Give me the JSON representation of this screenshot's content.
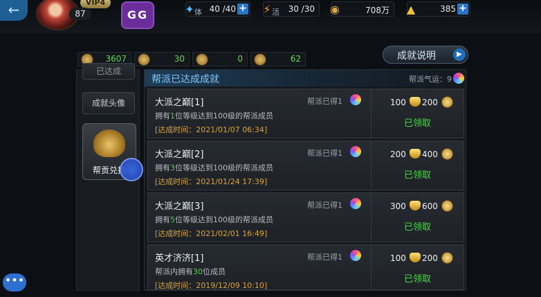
{
  "topbar": {
    "back_icon": "←",
    "vip": "VIP4",
    "level": "87",
    "gg_label": "GG",
    "stamina": {
      "label": "体",
      "value": "40 /40",
      "plus": "+"
    },
    "energy": {
      "label": "活",
      "value": "30 /30"
    },
    "coins": {
      "value": "708万"
    },
    "gold": {
      "value": "385",
      "plus": "+"
    }
  },
  "currencies": [
    {
      "icon": "coin-icon",
      "value": "3607"
    },
    {
      "icon": "helmet-icon",
      "value": "30"
    },
    {
      "icon": "emblem-icon",
      "value": "0"
    },
    {
      "icon": "scroll-icon",
      "value": "62"
    }
  ],
  "explain_button": {
    "label": "成就说明",
    "arrow": "▶"
  },
  "left_menu": {
    "items": [
      "已达成",
      "成就头像"
    ],
    "exchange_label": "帮贡兑换"
  },
  "panel": {
    "title": "帮派已达成成就",
    "luck_label": "帮派气运：9",
    "rows": [
      {
        "name": "大派之巅[1]",
        "desc_pre": "拥有",
        "desc_num": "1",
        "desc_post": "位等级达到100级的帮派成员",
        "time": "[达成时间：2021/01/07  06:34]",
        "gain": "帮派已得1",
        "reward1": "100",
        "reward2": "200",
        "status": "已领取"
      },
      {
        "name": "大派之巅[2]",
        "desc_pre": "拥有",
        "desc_num": "3",
        "desc_post": "位等级达到100级的帮派成员",
        "time": "[达成时间：2021/01/24  17:39]",
        "gain": "帮派已得1",
        "reward1": "200",
        "reward2": "400",
        "status": "已领取"
      },
      {
        "name": "大派之巅[3]",
        "desc_pre": "拥有",
        "desc_num": "5",
        "desc_post": "位等级达到100级的帮派成员",
        "time": "[达成时间：2021/02/01  16:49]",
        "gain": "帮派已得1",
        "reward1": "300",
        "reward2": "600",
        "status": "已领取"
      },
      {
        "name": "英才济济[1]",
        "desc_pre": "帮派内拥有",
        "desc_num": "30",
        "desc_post": "位成员",
        "time": "[达成时间：2019/12/09  10:10]",
        "gain": "帮派已得1",
        "reward1": "100",
        "reward2": "200",
        "status": "已领取"
      }
    ]
  },
  "chat_icon": "•••"
}
